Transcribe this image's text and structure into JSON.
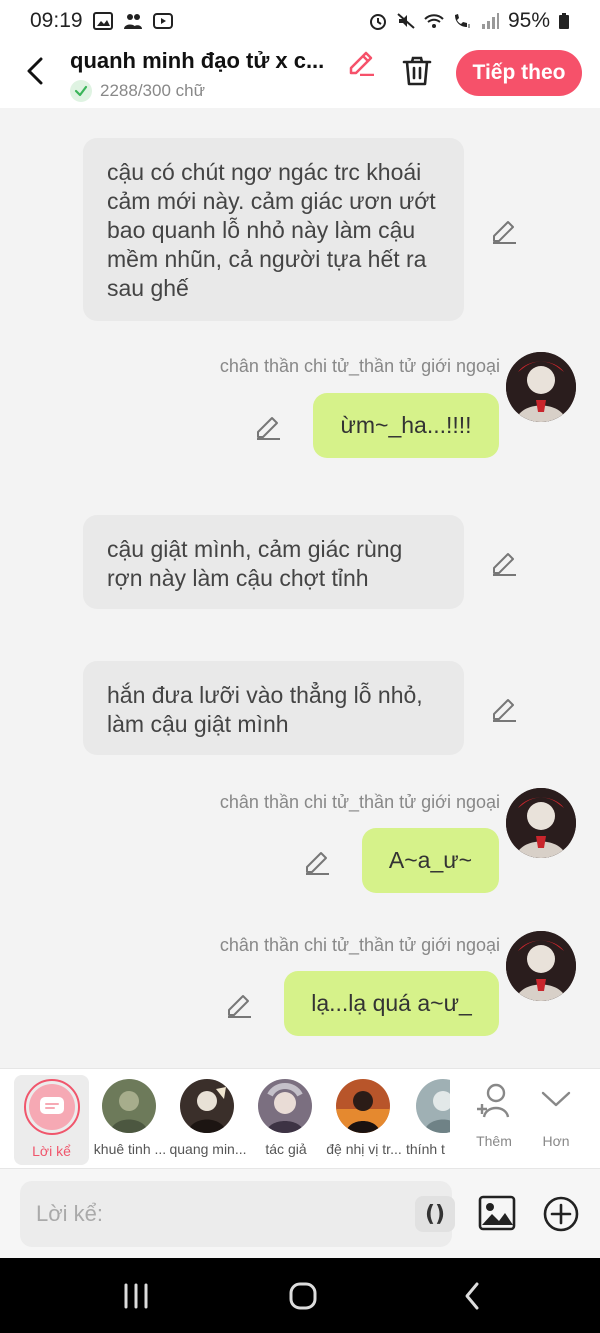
{
  "status_bar": {
    "time": "09:19",
    "battery": "95%"
  },
  "header": {
    "title": "quanh minh đạo tử x c...",
    "word_count": "2288/300 chữ",
    "follow_label": "Tiếp theo"
  },
  "messages": [
    {
      "type": "narration",
      "text": "cậu có chút ngơ ngác trc khoái cảm mới này. cảm giác ươn ướt bao quanh lỗ nhỏ này làm cậu mềm nhũn, cả người tựa hết ra sau ghế"
    },
    {
      "type": "user",
      "speaker": "chân thần chi tử_thần tử giới ngoại",
      "text": "ừm~_ha...!!!!"
    },
    {
      "type": "narration",
      "text": "cậu giật mình, cảm giác rùng rợn này làm cậu chợt tỉnh"
    },
    {
      "type": "narration",
      "text": "hắn đưa lưỡi vào thẳng lỗ nhỏ, làm cậu giật mình"
    },
    {
      "type": "user",
      "speaker": "chân thần chi tử_thần tử giới ngoại",
      "text": "A~a_ư~"
    },
    {
      "type": "user",
      "speaker": "chân thần chi tử_thần tử giới ngoại",
      "text": "lạ...lạ quá a~ư_"
    }
  ],
  "character_strip": {
    "narrator_label": "Lời kể",
    "characters": [
      {
        "name": "khuê tinh ...",
        "color": "#6d7a5a"
      },
      {
        "name": "quang min...",
        "color": "#3a2f2a"
      },
      {
        "name": "tác giả",
        "color": "#7b6f80"
      },
      {
        "name": "đệ nhị vị tr...",
        "color": "#b8552a"
      },
      {
        "name": "thính t",
        "color": "#9fb0b4"
      }
    ],
    "more_label": "Thêm",
    "expand_label": "Hơn"
  },
  "input": {
    "placeholder": "Lời kể:",
    "paren_label": "()"
  },
  "colors": {
    "accent": "#f6516a",
    "user_bubble": "#d6f28a",
    "narration_bubble": "#e9e9e9"
  }
}
